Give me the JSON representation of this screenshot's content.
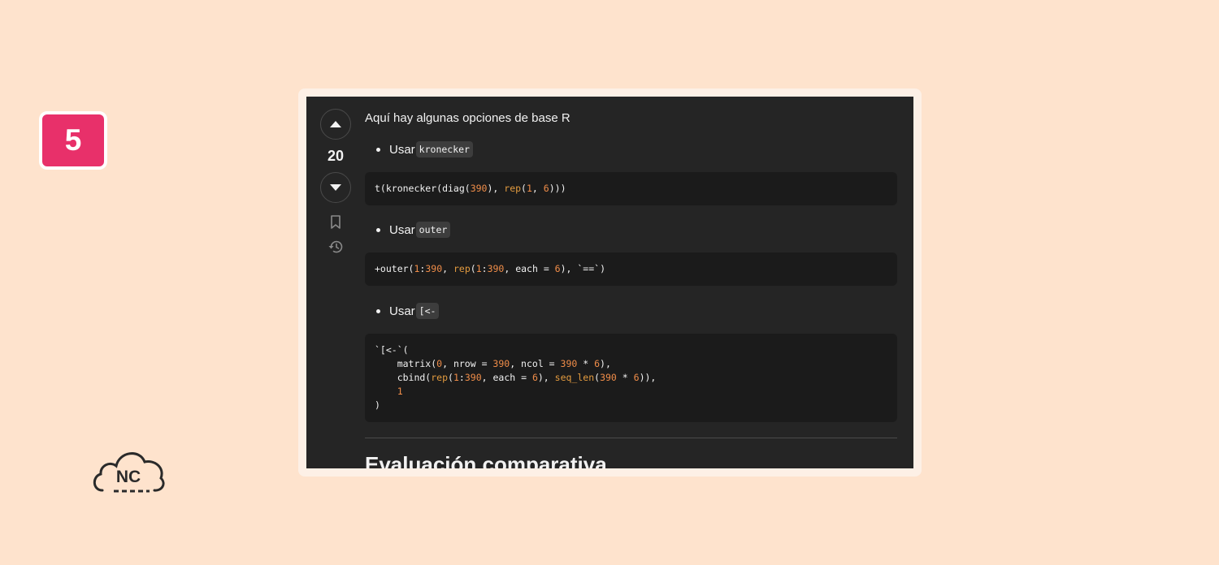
{
  "step_badge": "5",
  "logo": {
    "text": "NC"
  },
  "post": {
    "vote_count": "20",
    "intro": "Aquí hay algunas opciones de base R",
    "options": [
      {
        "prefix": "Usar",
        "code": "kronecker"
      },
      {
        "prefix": "Usar",
        "code": "outer"
      },
      {
        "prefix": "Usar",
        "code": "[<-"
      }
    ],
    "heading": "Evaluación comparativa"
  },
  "colors": {
    "background": "#fee3cd",
    "badge": "#e8306a",
    "post_bg": "#252525",
    "code_bg": "#1b1b1b",
    "code_number": "#f08d49"
  }
}
